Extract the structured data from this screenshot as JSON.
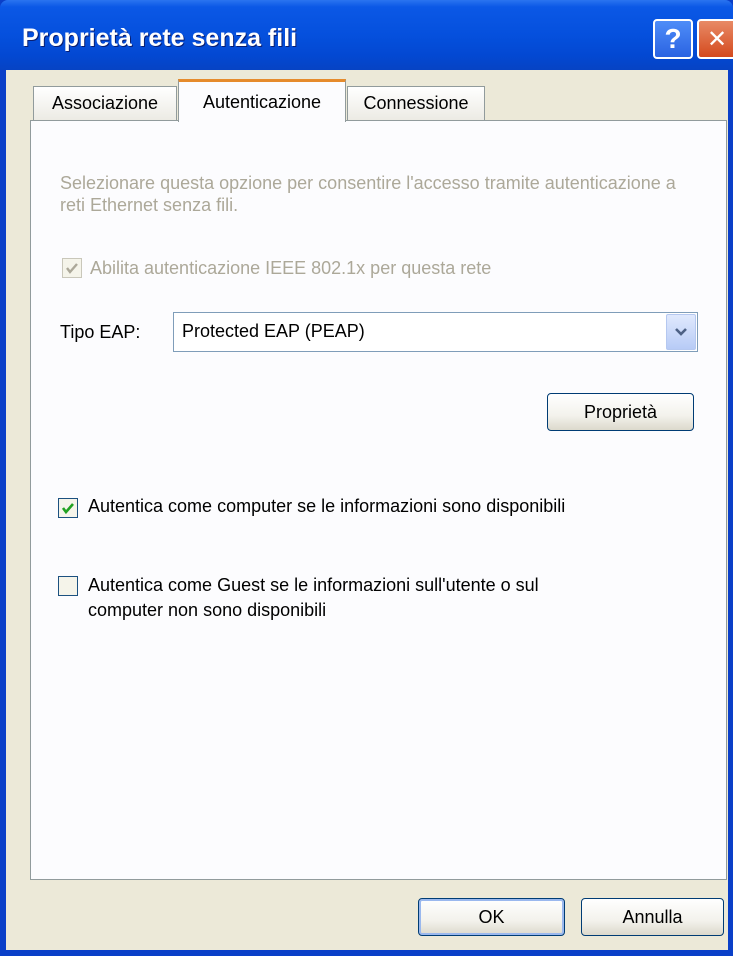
{
  "window": {
    "title": "Proprietà rete senza fili",
    "help_glyph": "?",
    "close_glyph": "✕"
  },
  "tabs": [
    {
      "label": "Associazione",
      "active": false
    },
    {
      "label": "Autenticazione",
      "active": true
    },
    {
      "label": "Connessione",
      "active": false
    }
  ],
  "authentication": {
    "description": "Selezionare questa opzione per consentire l'accesso tramite autenticazione a reti Ethernet senza fili.",
    "enable_8021x": {
      "label": "Abilita autenticazione IEEE 802.1x per questa rete",
      "checked": true,
      "enabled": false
    },
    "eap_type_label": "Tipo EAP:",
    "eap_type_value": "Protected EAP (PEAP)",
    "properties_button": "Proprietà",
    "auth_as_computer": {
      "label": "Autentica come computer se le informazioni sono disponibili",
      "checked": true
    },
    "auth_as_guest": {
      "label_line1": "Autentica come Guest se le informazioni sull'utente o sul",
      "label_line2": "computer non sono disponibili",
      "checked": false
    }
  },
  "footer": {
    "ok_label": "OK",
    "cancel_label": "Annulla"
  },
  "colors": {
    "titlebar": "#0550dd",
    "dialog_face": "#ece9d8",
    "active_tab_accent": "#e68b2c",
    "disabled_text": "#aca899",
    "checkmark": "#21a121"
  }
}
